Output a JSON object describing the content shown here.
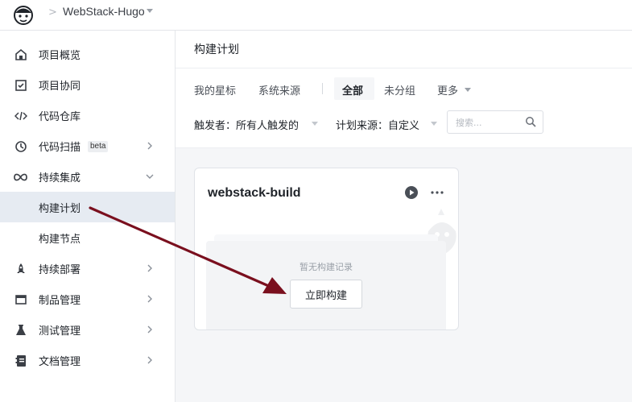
{
  "topbar": {
    "separator": ">",
    "project_name": "WebStack-Hugo"
  },
  "sidebar": {
    "items": [
      {
        "label": "项目概览",
        "icon": "home-icon"
      },
      {
        "label": "项目协同",
        "icon": "checkbox-icon"
      },
      {
        "label": "代码仓库",
        "icon": "code-icon"
      },
      {
        "label": "代码扫描",
        "icon": "scan-icon",
        "badge": "beta"
      },
      {
        "label": "持续集成",
        "icon": "infinity-icon"
      },
      {
        "label": "构建计划"
      },
      {
        "label": "构建节点"
      },
      {
        "label": "持续部署",
        "icon": "rocket-icon"
      },
      {
        "label": "制品管理",
        "icon": "package-icon"
      },
      {
        "label": "测试管理",
        "icon": "flask-icon"
      },
      {
        "label": "文档管理",
        "icon": "document-icon"
      }
    ]
  },
  "main": {
    "title": "构建计划",
    "tabs": [
      {
        "label": "我的星标"
      },
      {
        "label": "系统来源"
      },
      {
        "label": "全部"
      },
      {
        "label": "未分组"
      },
      {
        "label": "更多"
      }
    ],
    "filters": {
      "trigger_label": "触发者：所有人触发的",
      "source_label": "计划来源：自定义",
      "search_placeholder": "搜索..."
    },
    "card": {
      "title": "webstack-build",
      "empty_text": "暂无构建记录",
      "build_button": "立即构建"
    }
  },
  "colors": {
    "active_nav_bg": "#e6ebf2",
    "annotation_arrow": "#7a0f1e"
  }
}
